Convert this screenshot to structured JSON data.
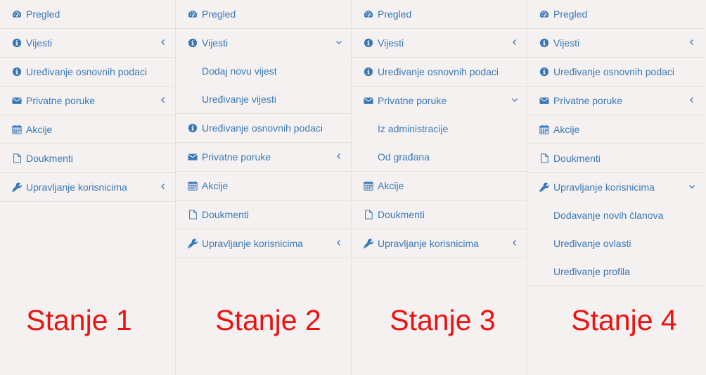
{
  "panels": [
    {
      "state_label": "Stanje 1",
      "items": [
        {
          "label": "Pregled",
          "icon": "dashboard-icon"
        },
        {
          "label": "Vijesti",
          "icon": "info-icon",
          "chevron": "left"
        },
        {
          "label": "Uređivanje osnovnih podaci",
          "icon": "info-icon"
        },
        {
          "label": "Privatne poruke",
          "icon": "envelope-icon",
          "chevron": "left"
        },
        {
          "label": "Akcije",
          "icon": "calendar-icon"
        },
        {
          "label": "Doukmenti",
          "icon": "document-icon"
        },
        {
          "label": "Upravljanje korisnicima",
          "icon": "wrench-icon",
          "chevron": "left"
        }
      ]
    },
    {
      "state_label": "Stanje 2",
      "items": [
        {
          "label": "Pregled",
          "icon": "dashboard-icon"
        },
        {
          "label": "Vijesti",
          "icon": "info-icon",
          "chevron": "down",
          "submenu": [
            "Dodaj novu vijest",
            "Uređivanje vijesti"
          ]
        },
        {
          "label": "Uređivanje osnovnih podaci",
          "icon": "info-icon"
        },
        {
          "label": "Privatne poruke",
          "icon": "envelope-icon",
          "chevron": "left"
        },
        {
          "label": "Akcije",
          "icon": "calendar-icon"
        },
        {
          "label": "Doukmenti",
          "icon": "document-icon"
        },
        {
          "label": "Upravljanje korisnicima",
          "icon": "wrench-icon",
          "chevron": "left"
        }
      ]
    },
    {
      "state_label": "Stanje 3",
      "items": [
        {
          "label": "Pregled",
          "icon": "dashboard-icon"
        },
        {
          "label": "Vijesti",
          "icon": "info-icon",
          "chevron": "left"
        },
        {
          "label": "Uređivanje osnovnih podaci",
          "icon": "info-icon"
        },
        {
          "label": "Privatne poruke",
          "icon": "envelope-icon",
          "chevron": "down",
          "submenu": [
            "Iz administracije",
            "Od građana"
          ]
        },
        {
          "label": "Akcije",
          "icon": "calendar-icon"
        },
        {
          "label": "Doukmenti",
          "icon": "document-icon"
        },
        {
          "label": "Upravljanje korisnicima",
          "icon": "wrench-icon",
          "chevron": "left"
        }
      ]
    },
    {
      "state_label": "Stanje 4",
      "items": [
        {
          "label": "Pregled",
          "icon": "dashboard-icon"
        },
        {
          "label": "Vijesti",
          "icon": "info-icon",
          "chevron": "left"
        },
        {
          "label": "Uređivanje osnovnih podaci",
          "icon": "info-icon"
        },
        {
          "label": "Privatne poruke",
          "icon": "envelope-icon",
          "chevron": "left"
        },
        {
          "label": "Akcije",
          "icon": "calendar-icon"
        },
        {
          "label": "Doukmenti",
          "icon": "document-icon"
        },
        {
          "label": "Upravljanje korisnicima",
          "icon": "wrench-icon",
          "chevron": "down",
          "submenu": [
            "Dodavanje novih članova",
            "Uređivanje ovlasti",
            "Uređivanje profila"
          ]
        }
      ]
    }
  ],
  "colors": {
    "link": "#3a79b8",
    "state_label": "#ee1111",
    "background": "#f5f1f1",
    "divider": "#e4e0e0"
  }
}
